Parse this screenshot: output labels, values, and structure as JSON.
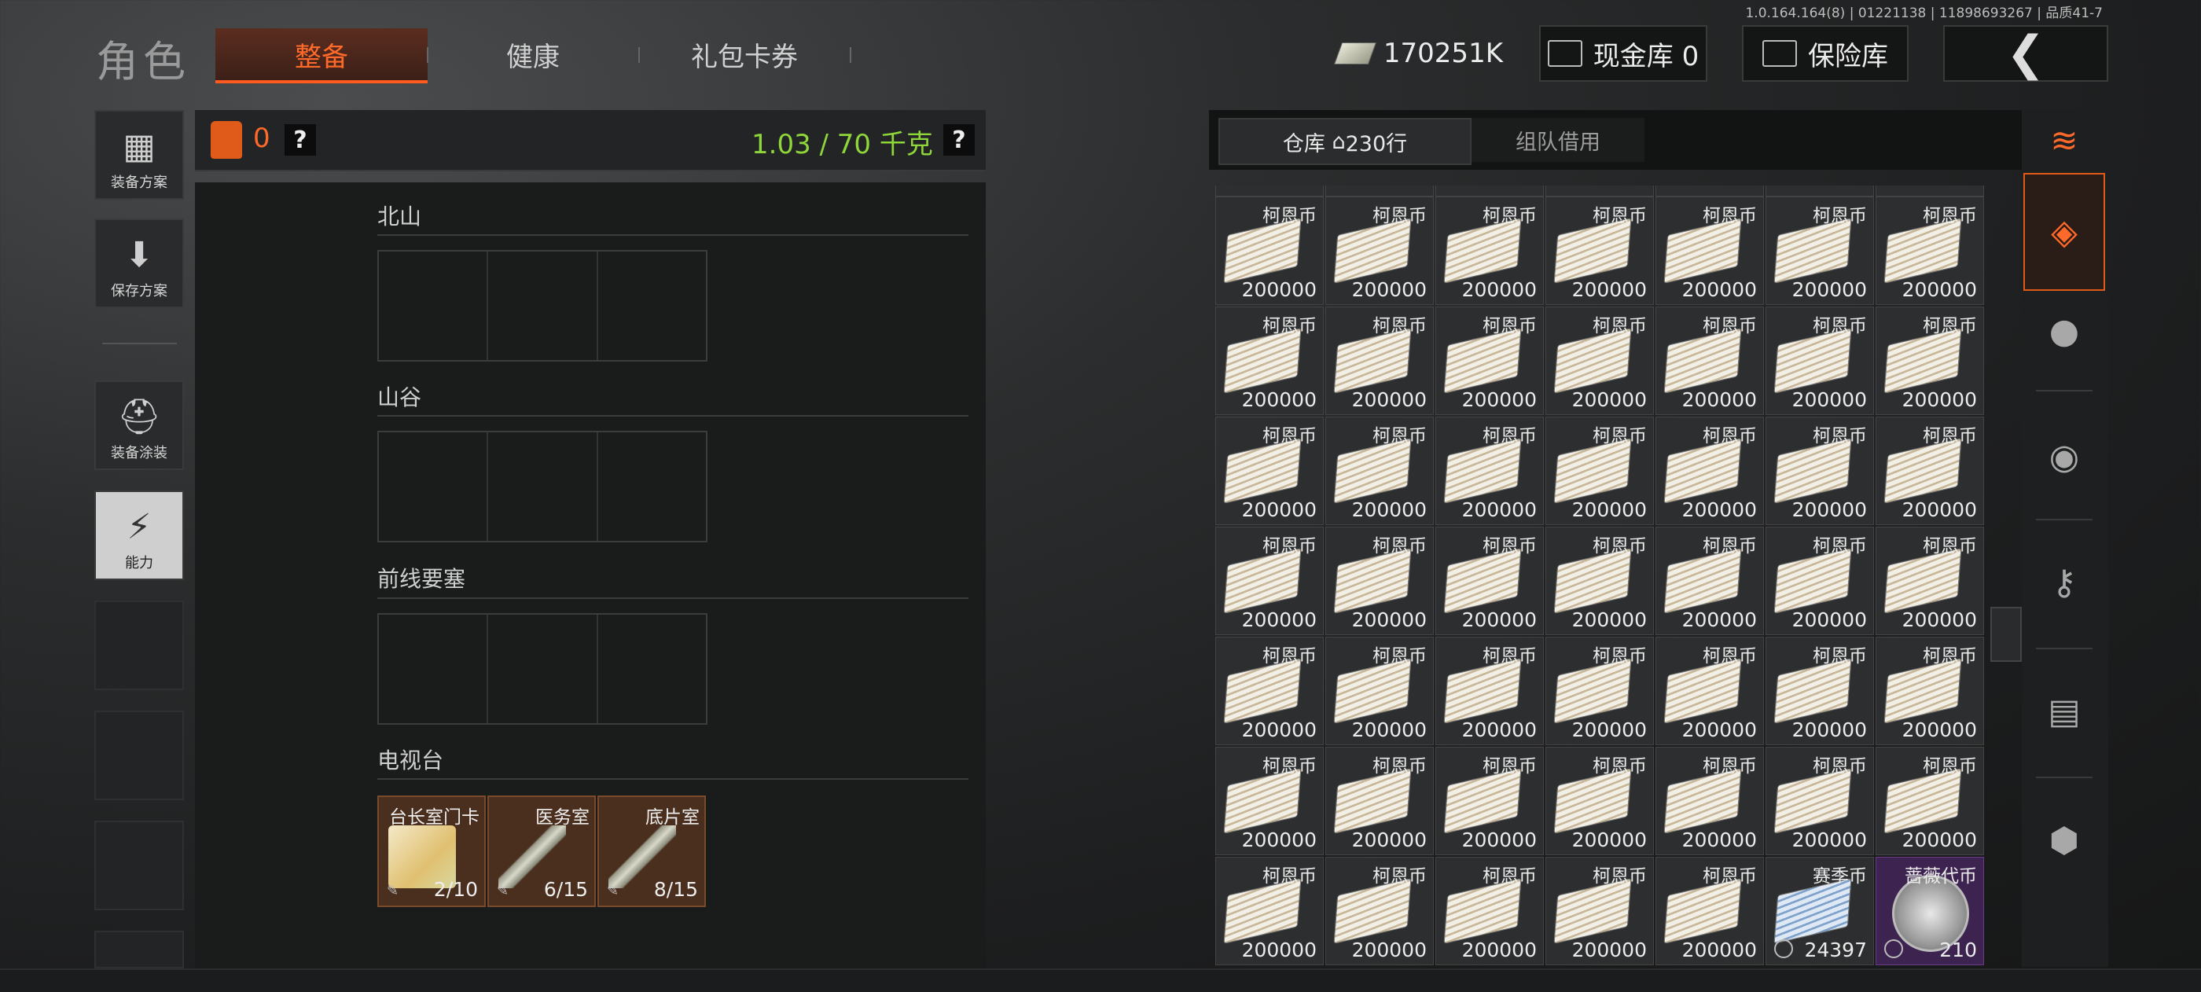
{
  "version": "1.0.164.164(8) | 01221138 | 11898693267 | 品质41-7",
  "title": "角色",
  "tabs": [
    {
      "label": "整备",
      "active": true
    },
    {
      "label": "健康",
      "active": false
    },
    {
      "label": "礼包卡券",
      "active": false
    }
  ],
  "header": {
    "cash": "170251K",
    "cash_vault_label": "现金库",
    "cash_vault_value": "0",
    "safe_label": "保险库",
    "back_glyph": "❮"
  },
  "sidebar": [
    {
      "label": "装备方案",
      "icon": "vest-icon"
    },
    {
      "label": "保存方案",
      "icon": "download-icon"
    },
    {
      "label": "装备涂装",
      "icon": "helmet-icon"
    },
    {
      "label": "能力",
      "icon": "ability-icon"
    }
  ],
  "loadout": {
    "vest_count": "0",
    "help": "?",
    "weight": "1.03 / 70 千克"
  },
  "sections": [
    {
      "title": "北山"
    },
    {
      "title": "山谷"
    },
    {
      "title": "前线要塞"
    },
    {
      "title": "电视台"
    }
  ],
  "tv_keys": [
    {
      "name": "台长室门卡",
      "count": "2/10",
      "art": "card"
    },
    {
      "name": "医务室",
      "count": "6/15",
      "art": "key"
    },
    {
      "name": "底片室",
      "count": "8/15",
      "art": "key"
    }
  ],
  "storage": {
    "tab_warehouse": "仓库",
    "rows": "230行",
    "tab_team": "组队借用"
  },
  "grid_rows": [
    [
      {
        "name": "柯恩币",
        "count": "200000"
      },
      {
        "name": "柯恩币",
        "count": "200000"
      },
      {
        "name": "柯恩币",
        "count": "200000"
      },
      {
        "name": "柯恩币",
        "count": "200000"
      },
      {
        "name": "柯恩币",
        "count": "200000"
      },
      {
        "name": "柯恩币",
        "count": "200000"
      },
      {
        "name": "柯恩币",
        "count": "200000"
      }
    ],
    [
      {
        "name": "柯恩币",
        "count": "200000"
      },
      {
        "name": "柯恩币",
        "count": "200000"
      },
      {
        "name": "柯恩币",
        "count": "200000"
      },
      {
        "name": "柯恩币",
        "count": "200000"
      },
      {
        "name": "柯恩币",
        "count": "200000"
      },
      {
        "name": "柯恩币",
        "count": "200000"
      },
      {
        "name": "柯恩币",
        "count": "200000"
      }
    ],
    [
      {
        "name": "柯恩币",
        "count": "200000"
      },
      {
        "name": "柯恩币",
        "count": "200000"
      },
      {
        "name": "柯恩币",
        "count": "200000"
      },
      {
        "name": "柯恩币",
        "count": "200000"
      },
      {
        "name": "柯恩币",
        "count": "200000"
      },
      {
        "name": "柯恩币",
        "count": "200000"
      },
      {
        "name": "柯恩币",
        "count": "200000"
      }
    ],
    [
      {
        "name": "柯恩币",
        "count": "200000"
      },
      {
        "name": "柯恩币",
        "count": "200000"
      },
      {
        "name": "柯恩币",
        "count": "200000"
      },
      {
        "name": "柯恩币",
        "count": "200000"
      },
      {
        "name": "柯恩币",
        "count": "200000"
      },
      {
        "name": "柯恩币",
        "count": "200000"
      },
      {
        "name": "柯恩币",
        "count": "200000"
      }
    ],
    [
      {
        "name": "柯恩币",
        "count": "200000"
      },
      {
        "name": "柯恩币",
        "count": "200000"
      },
      {
        "name": "柯恩币",
        "count": "200000"
      },
      {
        "name": "柯恩币",
        "count": "200000"
      },
      {
        "name": "柯恩币",
        "count": "200000"
      },
      {
        "name": "柯恩币",
        "count": "200000"
      },
      {
        "name": "柯恩币",
        "count": "200000"
      }
    ],
    [
      {
        "name": "柯恩币",
        "count": "200000"
      },
      {
        "name": "柯恩币",
        "count": "200000"
      },
      {
        "name": "柯恩币",
        "count": "200000"
      },
      {
        "name": "柯恩币",
        "count": "200000"
      },
      {
        "name": "柯恩币",
        "count": "200000"
      },
      {
        "name": "柯恩币",
        "count": "200000"
      },
      {
        "name": "柯恩币",
        "count": "200000"
      }
    ],
    [
      {
        "name": "柯恩币",
        "count": "200000"
      },
      {
        "name": "柯恩币",
        "count": "200000"
      },
      {
        "name": "柯恩币",
        "count": "200000"
      },
      {
        "name": "柯恩币",
        "count": "200000"
      },
      {
        "name": "柯恩币",
        "count": "200000"
      },
      {
        "name": "赛季币",
        "count": "24397",
        "art": "blue"
      },
      {
        "name": "蔷薇代币",
        "count": "210",
        "art": "coin"
      }
    ]
  ],
  "categories": [
    {
      "icon": "layers-refresh-icon"
    },
    {
      "icon": "all-items-icon"
    },
    {
      "icon": "grenade-icon"
    },
    {
      "icon": "parts-icon"
    },
    {
      "icon": "key-icon"
    },
    {
      "icon": "cash-icon"
    },
    {
      "icon": "box-icon"
    }
  ],
  "colors": {
    "accent": "#ff6a2a",
    "weight_green": "#8fd63a",
    "purple_rarity": "#3d2350"
  }
}
